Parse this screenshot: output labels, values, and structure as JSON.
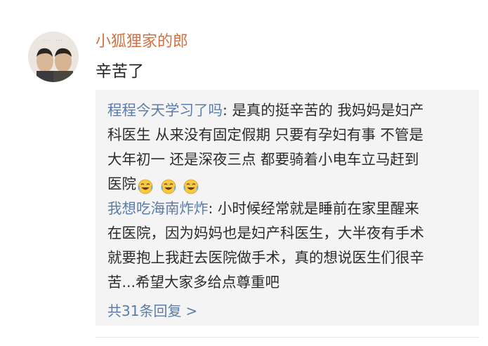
{
  "comment": {
    "author": "小狐狸家的郎",
    "text": "辛苦了",
    "avatar_icon": "avatar-two-people-photo-icon"
  },
  "replies": [
    {
      "author": "程程今天学习了吗",
      "separator": ": ",
      "lines": [
        "是真的挺辛苦的 我妈妈是妇产",
        "科医生 从来没有固定假期 只要有孕妇有事 不管是",
        "大年初一 还是深夜三点 都要骑着小电车立马赶到",
        "医院"
      ],
      "emojis": [
        "laugh-cry-icon",
        "laugh-cry-icon",
        "laugh-cry-icon"
      ]
    },
    {
      "author": "我想吃海南炸炸",
      "separator": ": ",
      "lines": [
        "小时候经常就是睡前在家里醒来",
        "在医院，因为妈妈也是妇产科医生，大半夜有手术",
        "就要抱上我赶去医院做手术，真的想说医生们很辛",
        "苦...希望大家多给点尊重吧"
      ]
    }
  ],
  "more_replies": {
    "label": "共31条回复",
    "chevron": ">"
  },
  "colors": {
    "username": "#d4713f",
    "reply_author": "#5b7ca8",
    "reply_background": "#f4f4f4"
  }
}
